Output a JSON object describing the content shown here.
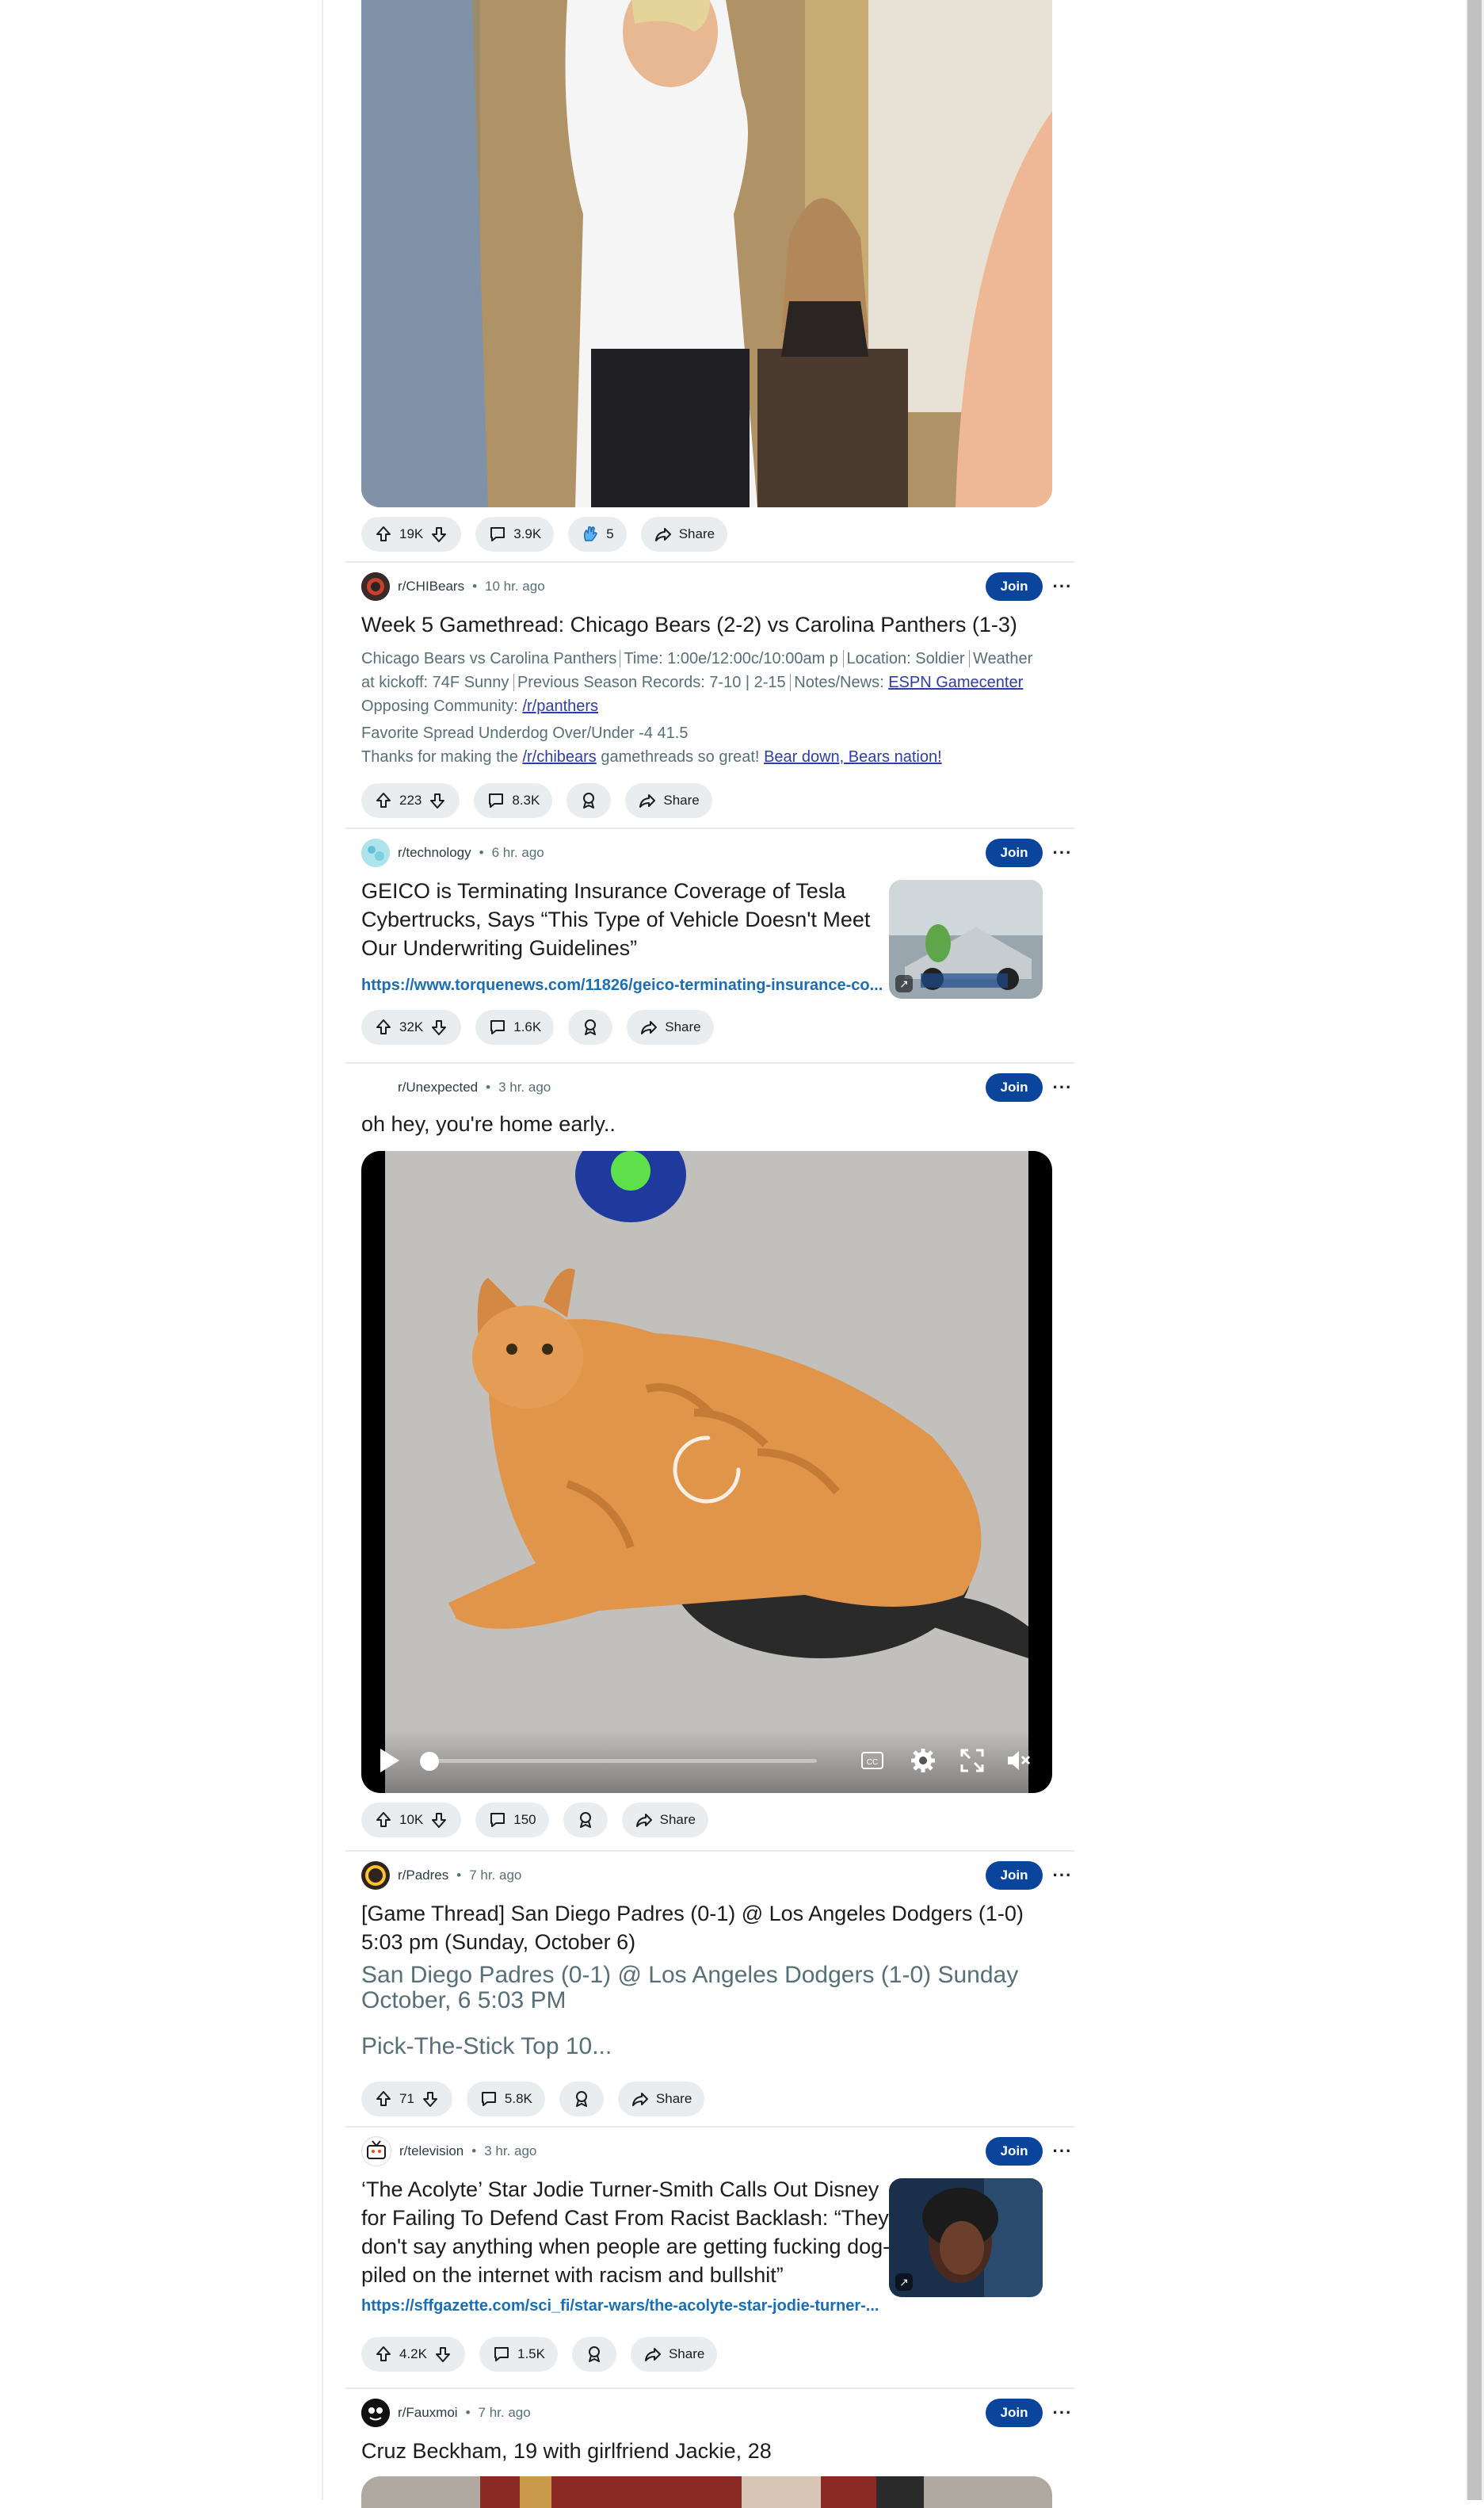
{
  "post_trump": {
    "actions": {
      "votes": "19K",
      "comments": "3.9K",
      "awards": "5",
      "share": "Share"
    }
  },
  "post_bears": {
    "subreddit": "r/CHIBears",
    "time": "10 hr. ago",
    "join": "Join",
    "title": "Week 5 Gamethread: Chicago Bears (2-2) vs Carolina Panthers (1-3)",
    "body_line1": "Chicago Bears vs Carolina Panthers",
    "body_time": "Time: 1:00e/12:00c/10:00am p",
    "body_location": "Location: Soldier",
    "body_weather": "Weather",
    "body_line2a": "at kickoff: 74F Sunny",
    "body_line2b": "Previous Season Records: 7-10 | 2-15",
    "body_line2c": "Notes/News:",
    "body_link_espn": "ESPN Gamecenter",
    "body_line3a": "Opposing Community:",
    "body_link_panthers": "/r/panthers",
    "body_line4": "Favorite Spread Underdog Over/Under -4 41.5",
    "body_line5a": "Thanks for making the",
    "body_link_chibears": "/r/chibears",
    "body_line5b": "gamethreads so great!",
    "body_link_beardown": "Bear down, Bears nation!",
    "actions": {
      "votes": "223",
      "comments": "8.3K",
      "share": "Share"
    }
  },
  "post_tech": {
    "subreddit": "r/technology",
    "time": "6 hr. ago",
    "join": "Join",
    "title": "GEICO is Terminating Insurance Coverage of Tesla Cybertrucks, Says “This Type of Vehicle Doesn't Meet Our Underwriting Guidelines”",
    "link": "https://www.torquenews.com/11826/geico-terminating-insurance-co...",
    "actions": {
      "votes": "32K",
      "comments": "1.6K",
      "share": "Share"
    }
  },
  "post_unexpected": {
    "subreddit": "r/Unexpected",
    "time": "3 hr. ago",
    "join": "Join",
    "title": "oh hey, you're home early..",
    "video": {
      "progress": 0.0,
      "muted": true
    },
    "actions": {
      "votes": "10K",
      "comments": "150",
      "share": "Share"
    }
  },
  "post_padres": {
    "subreddit": "r/Padres",
    "time": "7 hr. ago",
    "join": "Join",
    "title": "[Game Thread] San Diego Padres (0-1) @ Los Angeles Dodgers (1-0) 5:03 pm (Sunday, October 6)",
    "body": "San Diego Padres (0-1) @ Los Angeles Dodgers (1-0) Sunday October, 6 5:03 PM",
    "body2": "Pick-The-Stick Top 10...",
    "actions": {
      "votes": "71",
      "comments": "5.8K",
      "share": "Share"
    }
  },
  "post_tv": {
    "subreddit": "r/television",
    "time": "3 hr. ago",
    "join": "Join",
    "title": "‘The Acolyte’ Star Jodie Turner-Smith Calls Out Disney for Failing To Defend Cast From Racist Backlash: “They don't say anything when people are getting fucking dog-piled on the internet with racism and bullshit”",
    "link": "https://sffgazette.com/sci_fi/star-wars/the-acolyte-star-jodie-turner-...",
    "actions": {
      "votes": "4.2K",
      "comments": "1.5K",
      "share": "Share"
    }
  },
  "post_fauxmoi": {
    "subreddit": "r/Fauxmoi",
    "time": "7 hr. ago",
    "join": "Join",
    "title": "Cruz Beckham, 19 with girlfriend Jackie, 28"
  },
  "colors": {
    "join": "#0a449b",
    "pill": "#eaedef",
    "link": "#1a6eb5"
  }
}
